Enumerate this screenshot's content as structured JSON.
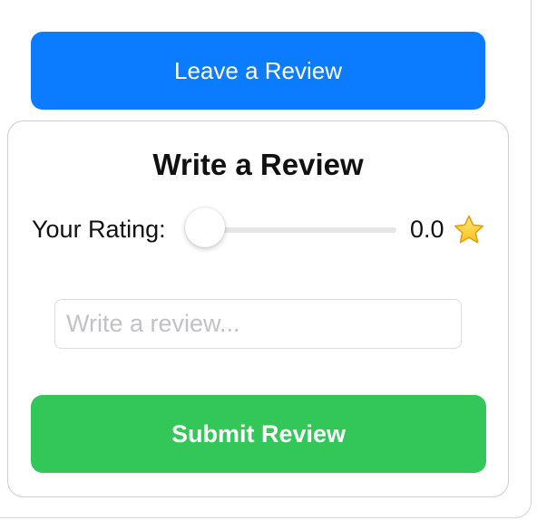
{
  "leave_review": {
    "label": "Leave a Review"
  },
  "review_form": {
    "title": "Write a Review",
    "rating_label": "Your Rating:",
    "rating_value": "0.0",
    "rating_fraction": 0.0,
    "review_placeholder": "Write a review...",
    "review_value": "",
    "submit_label": "Submit Review"
  },
  "icons": {
    "rating": "star-icon"
  },
  "colors": {
    "leave_button_bg": "#0b7cff",
    "submit_button_bg": "#33c659",
    "star_fill": "#ffcc33",
    "star_stroke": "#e5a00d"
  }
}
